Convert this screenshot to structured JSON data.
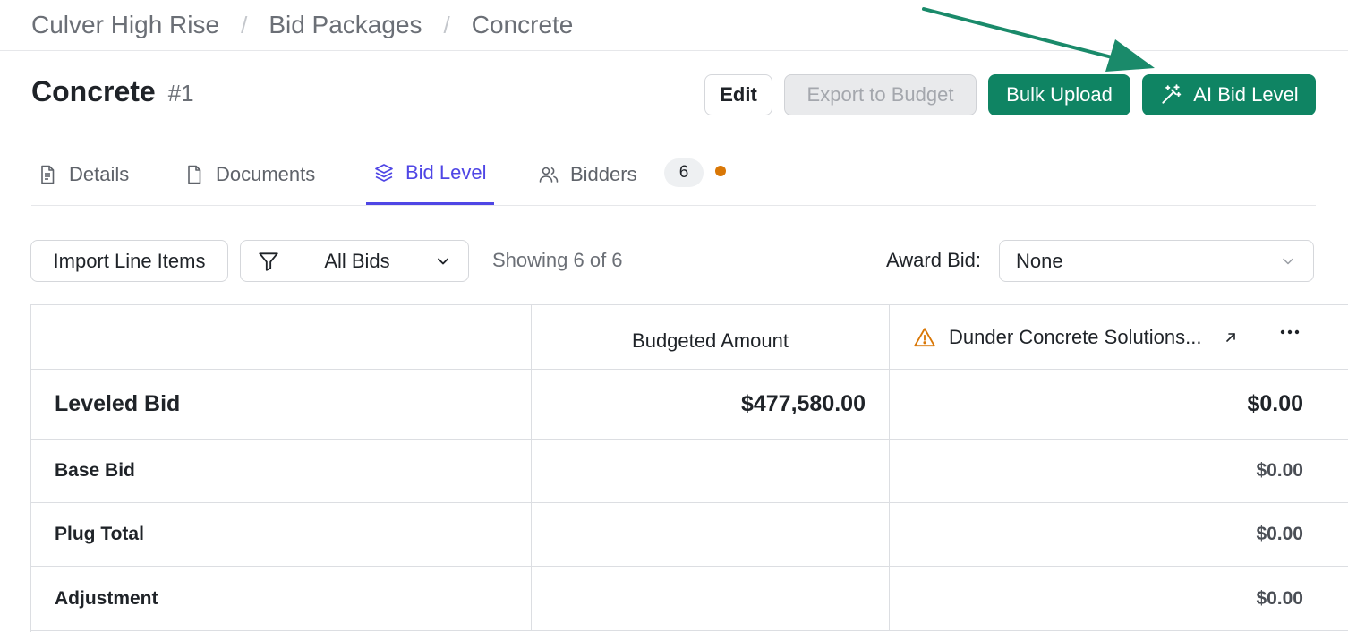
{
  "breadcrumb": {
    "items": [
      "Culver High Rise",
      "Bid Packages",
      "Concrete"
    ],
    "separator": "/"
  },
  "header": {
    "title": "Concrete",
    "number": "#1"
  },
  "actions": {
    "edit_label": "Edit",
    "export_label": "Export to Budget",
    "bulk_upload_label": "Bulk Upload",
    "ai_bid_level_label": "AI Bid Level"
  },
  "tabs": [
    {
      "label": "Details",
      "icon": "document-icon"
    },
    {
      "label": "Documents",
      "icon": "file-icon"
    },
    {
      "label": "Bid Level",
      "icon": "layers-icon",
      "active": true
    },
    {
      "label": "Bidders",
      "icon": "users-icon",
      "count": "6"
    }
  ],
  "toolbar": {
    "import_label": "Import Line Items",
    "filter_label": "All Bids",
    "showing_text": "Showing 6 of 6",
    "award_label": "Award Bid:",
    "award_value": "None"
  },
  "table": {
    "columns": [
      "",
      "Budgeted Amount",
      "Dunder Concrete Solutions..."
    ],
    "rows": [
      {
        "label": "Leveled Bid",
        "budgeted": "$477,580.00",
        "bidder": "$0.00"
      },
      {
        "label": "Base Bid",
        "budgeted": "",
        "bidder": "$0.00"
      },
      {
        "label": "Plug Total",
        "budgeted": "",
        "bidder": "$0.00"
      },
      {
        "label": "Adjustment",
        "budgeted": "",
        "bidder": "$0.00"
      }
    ]
  },
  "colors": {
    "brand_green": "#0f8463",
    "active_tab": "#4f46e5",
    "notification_dot": "#d97706",
    "warning": "#d97706"
  }
}
